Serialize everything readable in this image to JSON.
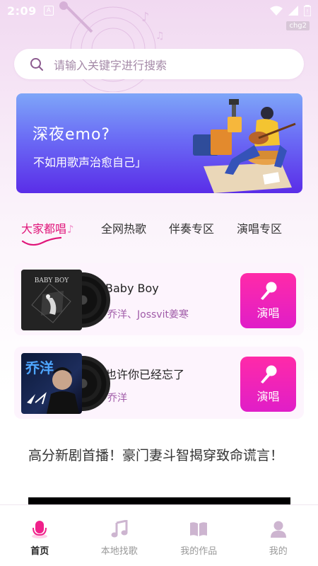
{
  "status_bar": {
    "time": "2:09",
    "badge": "chg2"
  },
  "search": {
    "placeholder": "请输入关键字进行搜索"
  },
  "banner": {
    "title": "深夜emo?",
    "subtitle": "不如用歌声治愈自己」"
  },
  "tabs": [
    {
      "label": "大家都唱",
      "active": true
    },
    {
      "label": "全网热歌",
      "active": false
    },
    {
      "label": "伴奏专区",
      "active": false
    },
    {
      "label": "演唱专区",
      "active": false
    }
  ],
  "songs": [
    {
      "title": "Baby Boy",
      "artist": "乔洋、Jossvit姜寒",
      "cover_text": "BABY BOY",
      "button": "演唱"
    },
    {
      "title": "也许你已经忘了",
      "artist": "乔洋",
      "cover_text": "乔洋",
      "button": "演唱"
    }
  ],
  "news": {
    "title": "高分新剧首播！豪门妻斗智揭穿致命谎言！"
  },
  "bottom_nav": [
    {
      "label": "首页",
      "icon": "mic-icon",
      "active": true
    },
    {
      "label": "本地找歌",
      "icon": "music-note-icon",
      "active": false
    },
    {
      "label": "我的作品",
      "icon": "book-icon",
      "active": false
    },
    {
      "label": "我的",
      "icon": "person-icon",
      "active": false
    }
  ],
  "colors": {
    "accent": "#e0167a",
    "button": "#ff2aa8",
    "banner": "#6b6cf5"
  }
}
